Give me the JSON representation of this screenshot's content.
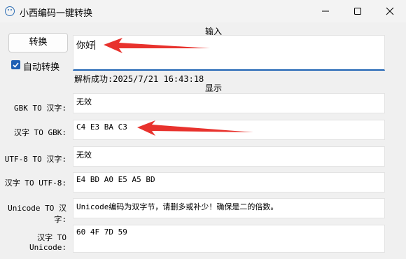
{
  "window": {
    "title": "小西编码一键转换"
  },
  "controls": {
    "convert_label": "转换",
    "auto_convert_label": "自动转换",
    "auto_convert_checked": true
  },
  "input": {
    "section_label": "输入",
    "value": "你好"
  },
  "status": "解析成功:2025/7/21 16:43:18",
  "output": {
    "section_label": "显示",
    "rows": [
      {
        "label": "GBK TO 汉字:",
        "value": "无效"
      },
      {
        "label": "汉字 TO GBK:",
        "value": "C4 E3 BA C3"
      },
      {
        "label": "UTF-8 TO 汉字:",
        "value": "无效"
      },
      {
        "label": "汉字 TO UTF-8:",
        "value": "E4 BD A0 E5 A5 BD"
      },
      {
        "label": "Unicode TO 汉字:",
        "value": "Unicode编码为双字节，请删多或补少！确保是二的倍数。"
      },
      {
        "label": "汉字 TO Unicode:",
        "value": "60 4F 7D 59"
      }
    ]
  },
  "colors": {
    "accent": "#1e63b4",
    "arrow": "#e8322d"
  }
}
